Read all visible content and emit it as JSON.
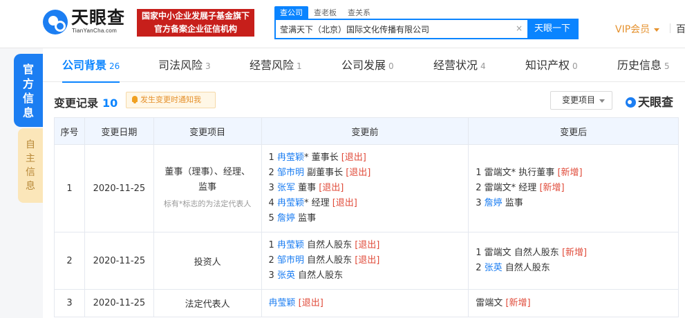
{
  "header": {
    "logo_cn": "天眼查",
    "logo_en": "TianYanCha.com",
    "badge_line1": "国家中小企业发展子基金旗下",
    "badge_line2": "官方备案企业征信机构",
    "search_tabs": [
      "查公司",
      "查老板",
      "查关系"
    ],
    "search_value": "莹满天下（北京）国际文化传播有限公司",
    "search_clear": "×",
    "search_button": "天眼一下",
    "vip_label": "VIP会员",
    "extra": "百"
  },
  "side": {
    "official": [
      "官",
      "方",
      "信",
      "息"
    ],
    "self": [
      "自",
      "主",
      "信",
      "息"
    ]
  },
  "tabs": [
    {
      "label": "公司背景",
      "count": "26"
    },
    {
      "label": "司法风险",
      "count": "3"
    },
    {
      "label": "经营风险",
      "count": "1"
    },
    {
      "label": "公司发展",
      "count": "0"
    },
    {
      "label": "经营状况",
      "count": "4"
    },
    {
      "label": "知识产权",
      "count": "0"
    },
    {
      "label": "历史信息",
      "count": "5"
    }
  ],
  "section": {
    "title": "变更记录",
    "count": "10",
    "notify_label": "发生变更时通知我",
    "filter_label": "变更项目",
    "watermark": "天眼查"
  },
  "table": {
    "headers": [
      "序号",
      "变更日期",
      "变更项目",
      "变更前",
      "变更后"
    ],
    "rows": [
      {
        "no": "1",
        "date": "2020-11-25",
        "item": "董事（理事）、经理、监事",
        "item_note": "标有*标志的为法定代表人",
        "before": [
          {
            "idx": "1",
            "name": "冉莹颖",
            "role": "* 董事长",
            "tag": "[退出]"
          },
          {
            "idx": "2",
            "name": "邹市明",
            "role": " 副董事长",
            "tag": "[退出]"
          },
          {
            "idx": "3",
            "name": "张军",
            "role": " 董事",
            "tag": "[退出]"
          },
          {
            "idx": "4",
            "name": "冉莹颖",
            "role": "* 经理",
            "tag": "[退出]"
          },
          {
            "idx": "5",
            "name": "詹婷",
            "role": " 监事",
            "tag": ""
          }
        ],
        "after": [
          {
            "idx": "1",
            "plain": "雷端文* 执行董事",
            "tag": "[新增]"
          },
          {
            "idx": "2",
            "plain": "雷端文* 经理",
            "tag": "[新增]"
          },
          {
            "idx": "3",
            "name": "詹婷",
            "role": " 监事",
            "tag": ""
          }
        ]
      },
      {
        "no": "2",
        "date": "2020-11-25",
        "item": "投资人",
        "before": [
          {
            "idx": "1",
            "name": "冉莹颖",
            "role": " 自然人股东",
            "tag": "[退出]"
          },
          {
            "idx": "2",
            "name": "邹市明",
            "role": " 自然人股东",
            "tag": "[退出]"
          },
          {
            "idx": "3",
            "name": "张英",
            "role": " 自然人股东",
            "tag": ""
          }
        ],
        "after": [
          {
            "idx": "1",
            "plain": "雷端文 自然人股东",
            "tag": "[新增]"
          },
          {
            "idx": "2",
            "name": "张英",
            "role": " 自然人股东",
            "tag": ""
          }
        ]
      },
      {
        "no": "3",
        "date": "2020-11-25",
        "item": "法定代表人",
        "before_single": {
          "name": "冉莹颖",
          "tag": "[退出]"
        },
        "after_single": {
          "plain": "雷端文",
          "tag": "[新增]"
        }
      }
    ]
  },
  "colors": {
    "accent": "#0a84ff",
    "brand_red": "#c71f1b",
    "vip": "#e5912d",
    "tag_red": "#e04b3a",
    "side_self_bg": "#fbe6b9"
  }
}
